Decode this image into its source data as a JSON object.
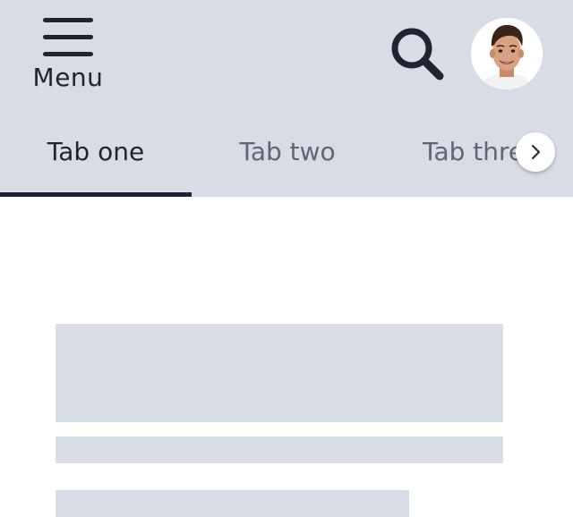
{
  "header": {
    "menu_label": "Menu",
    "search_icon": "search-icon",
    "menu_icon": "hamburger-icon",
    "avatar": "user-avatar"
  },
  "tabs": [
    {
      "label": "Tab one",
      "active": true
    },
    {
      "label": "Tab two",
      "active": false
    },
    {
      "label": "Tab three",
      "active": false
    }
  ],
  "tab_scroll_icon": "chevron-right-icon",
  "colors": {
    "header_background": "#d8dce4",
    "text_primary": "#1f2433",
    "text_secondary": "#5e6575",
    "skeleton": "#d8dce4"
  }
}
